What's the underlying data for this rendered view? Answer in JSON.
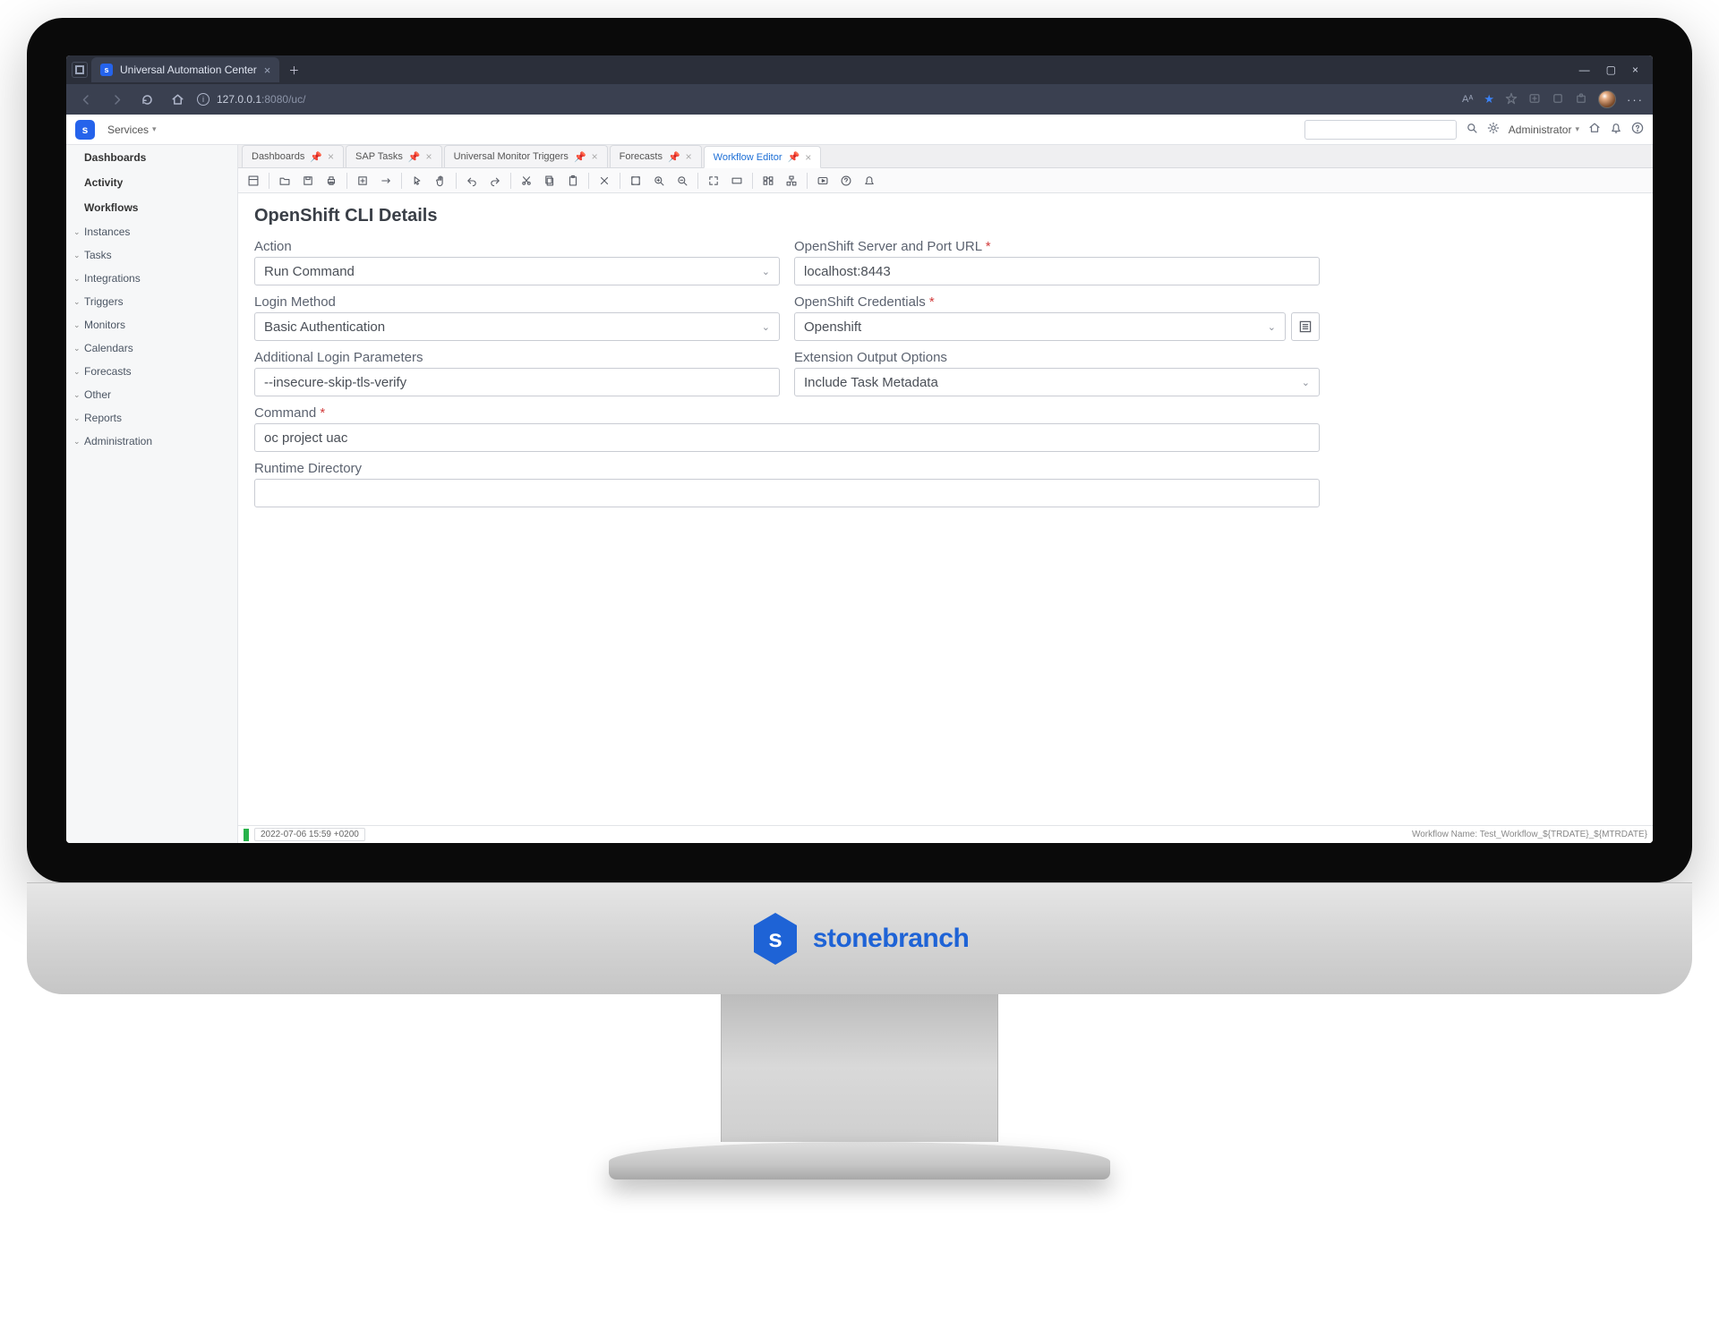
{
  "browser": {
    "tab_title": "Universal Automation Center",
    "url_host": "127.0.0.1",
    "url_path": ":8080/uc/"
  },
  "app_header": {
    "services_label": "Services",
    "admin_label": "Administrator"
  },
  "sidebar": {
    "dashboards": "Dashboards",
    "activity": "Activity",
    "workflows": "Workflows",
    "instances": "Instances",
    "tasks": "Tasks",
    "integrations": "Integrations",
    "triggers": "Triggers",
    "monitors": "Monitors",
    "calendars": "Calendars",
    "forecasts": "Forecasts",
    "other": "Other",
    "reports": "Reports",
    "administration": "Administration"
  },
  "tabs": {
    "t0": "Dashboards",
    "t1": "SAP Tasks",
    "t2": "Universal Monitor Triggers",
    "t3": "Forecasts",
    "t4": "Workflow Editor"
  },
  "section_title": "OpenShift CLI Details",
  "form": {
    "action": {
      "label": "Action",
      "value": "Run Command"
    },
    "server": {
      "label": "OpenShift Server and Port URL",
      "value": "localhost:8443"
    },
    "login_method": {
      "label": "Login Method",
      "value": "Basic Authentication"
    },
    "credentials": {
      "label": "OpenShift Credentials",
      "value": "Openshift"
    },
    "addl_params": {
      "label": "Additional Login Parameters",
      "value": "--insecure-skip-tls-verify"
    },
    "ext_output": {
      "label": "Extension Output Options",
      "value": "Include Task Metadata"
    },
    "command": {
      "label": "Command",
      "value": "oc project uac"
    },
    "runtime_dir": {
      "label": "Runtime Directory",
      "value": ""
    }
  },
  "status": {
    "timestamp": "2022-07-06 15:59 +0200",
    "workflow_name": "Workflow Name: Test_Workflow_${TRDATE}_${MTRDATE}"
  },
  "chin_brand": "stonebranch"
}
